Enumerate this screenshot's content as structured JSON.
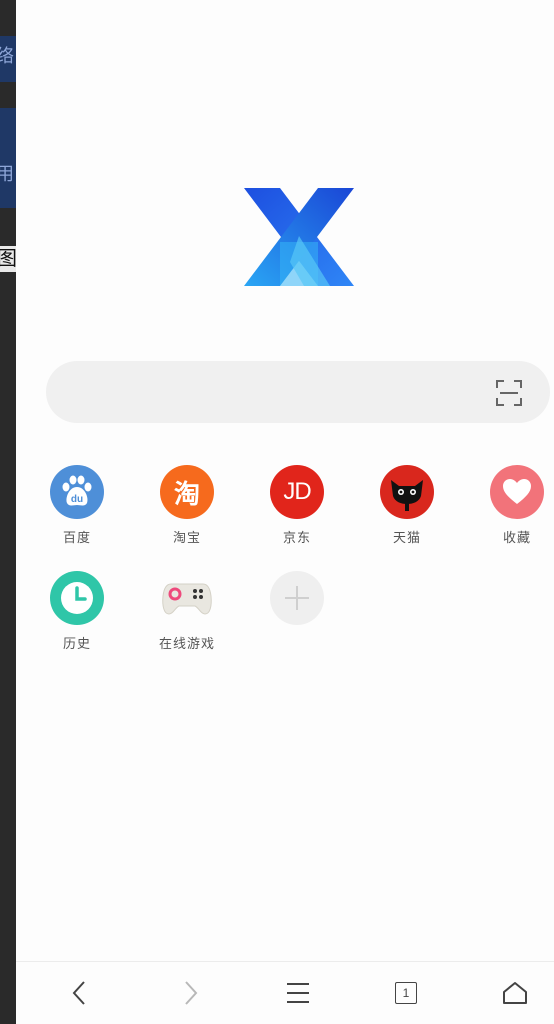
{
  "background_app": {
    "fragment_1": "络",
    "fragment_2": "用",
    "fragment_3": "图"
  },
  "search": {
    "placeholder": ""
  },
  "shortcuts": [
    {
      "label": "百度",
      "icon": "baidu-icon",
      "color": "#4e8fd8",
      "glyph": "du"
    },
    {
      "label": "淘宝",
      "icon": "taobao-icon",
      "color": "#f66a1d",
      "glyph": "淘"
    },
    {
      "label": "京东",
      "icon": "jd-icon",
      "color": "#e1251b",
      "glyph": "JD"
    },
    {
      "label": "天猫",
      "icon": "tmall-icon",
      "color": "#d9271d",
      "glyph": ""
    },
    {
      "label": "收藏",
      "icon": "heart-icon",
      "color": "#f2737a",
      "glyph": ""
    },
    {
      "label": "历史",
      "icon": "clock-icon",
      "color": "#2fc6a8",
      "glyph": ""
    },
    {
      "label": "在线游戏",
      "icon": "gamepad-icon",
      "color": "#eeeeee",
      "glyph": ""
    },
    {
      "label": "",
      "icon": "plus-icon",
      "color": "#efefef",
      "glyph": "+"
    }
  ],
  "bottom_nav": {
    "back": "chevron-left-icon",
    "forward": "chevron-right-icon",
    "menu": "menu-icon",
    "tabs_count": "1",
    "home": "home-icon"
  },
  "colors": {
    "accent": "#2f7df6",
    "logo_dark": "#1a5de8",
    "logo_light": "#35b4f5"
  }
}
